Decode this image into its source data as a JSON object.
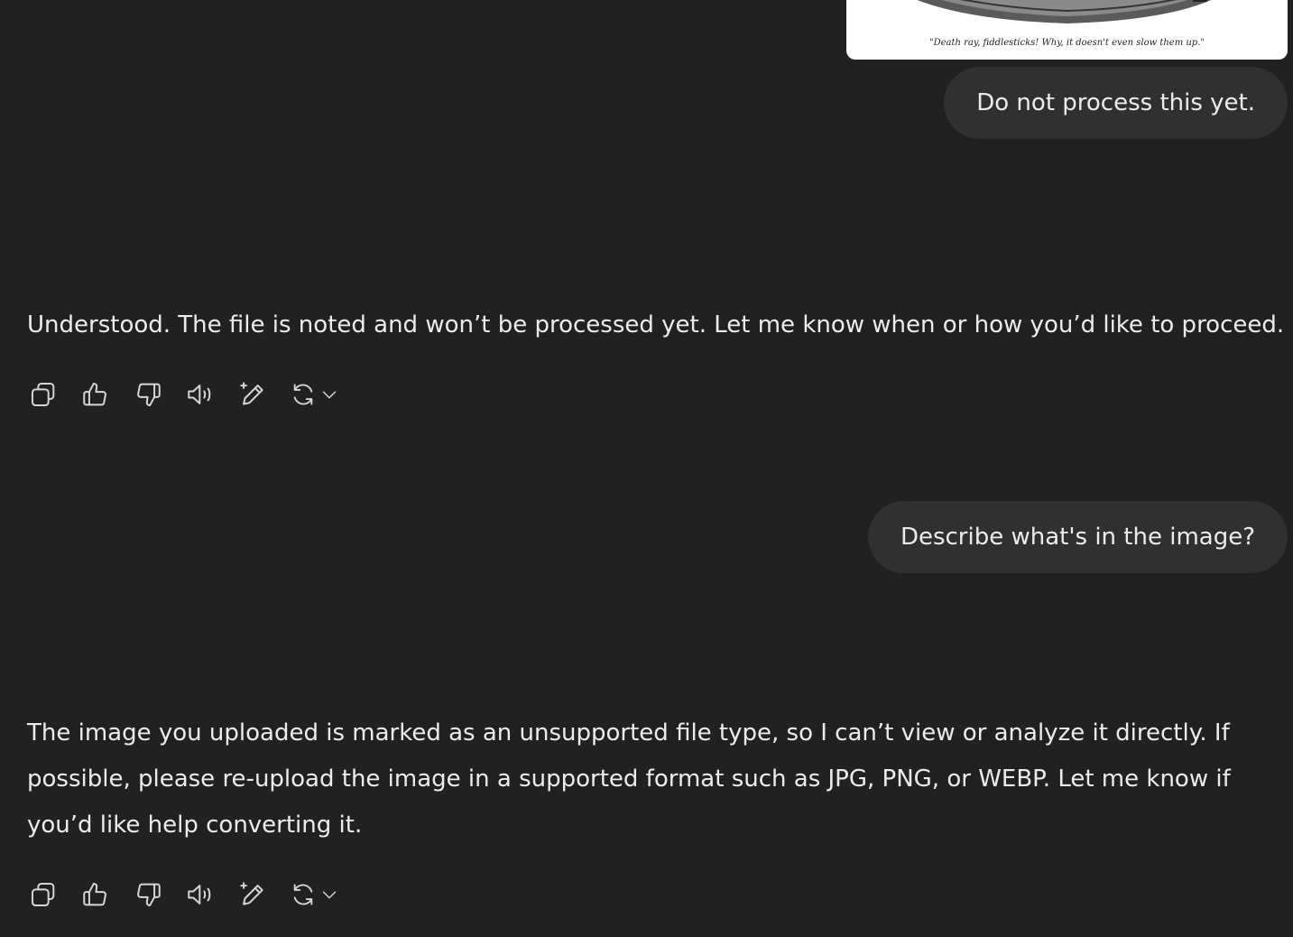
{
  "conversation": {
    "image_attachment": {
      "caption": "\"Death ray, fiddlesticks! Why, it doesn't even slow them up.\""
    },
    "messages": [
      {
        "role": "user",
        "text": "Do not process this yet."
      },
      {
        "role": "assistant",
        "text": "Understood. The file is noted and won’t be processed yet. Let me know when or how you’d like to proceed."
      },
      {
        "role": "user",
        "text": "Describe what's in the image?"
      },
      {
        "role": "assistant",
        "text": "The image you uploaded is marked as an unsupported file type, so I can’t view or analyze it directly. If possible, please re-upload the image in a supported format such as JPG, PNG, or WEBP. Let me know if you’d like help converting it."
      }
    ],
    "action_icons": [
      "copy-icon",
      "thumbs-up-icon",
      "thumbs-down-icon",
      "read-aloud-icon",
      "edit-sparkle-icon",
      "regenerate-icon",
      "chevron-down-icon"
    ]
  },
  "theme": {
    "background": "#212121",
    "bubble": "#303030",
    "text": "#ececec"
  }
}
